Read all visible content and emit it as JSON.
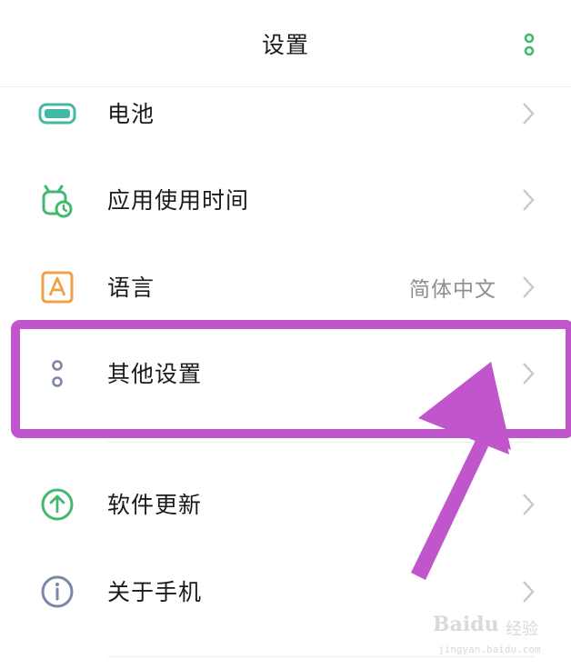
{
  "header": {
    "title": "设置",
    "more_icon": "more-vertical-dots-icon"
  },
  "colors": {
    "accent_green": "#43b86f",
    "highlight_purple": "#c155cc",
    "chevron_gray": "#c8c8c8",
    "value_gray": "#8e8e8e"
  },
  "rows": [
    {
      "label": "电池",
      "icon": "battery-icon",
      "value": ""
    },
    {
      "label": "应用使用时间",
      "icon": "app-usage-time-icon",
      "value": ""
    },
    {
      "label": "语言",
      "icon": "language-icon",
      "value": "简体中文"
    },
    {
      "label": "其他设置",
      "icon": "other-settings-icon",
      "value": ""
    },
    {
      "label": "软件更新",
      "icon": "software-update-icon",
      "value": ""
    },
    {
      "label": "关于手机",
      "icon": "about-phone-icon",
      "value": ""
    }
  ],
  "watermark": {
    "brand": "Baidu",
    "brand_cn": "经验",
    "url": "jingyan.baidu.com"
  }
}
